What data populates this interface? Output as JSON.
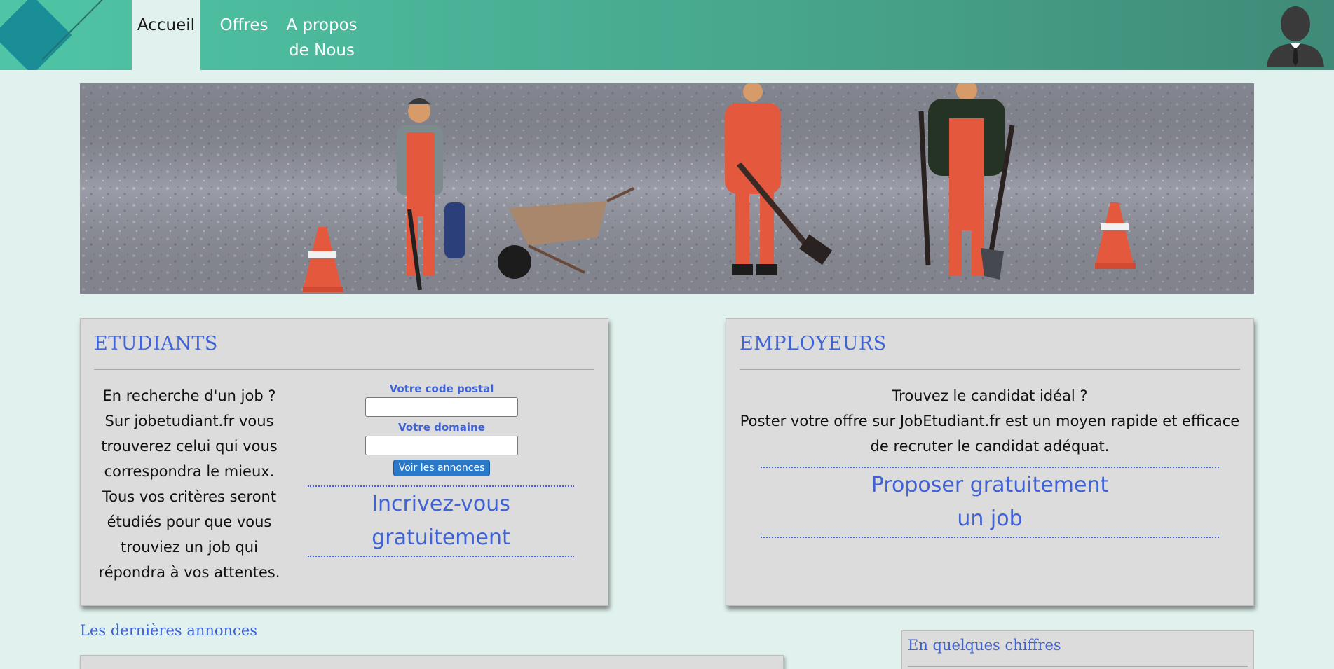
{
  "nav": {
    "items": [
      {
        "label": "Accueil",
        "active": true
      },
      {
        "label": "Offres",
        "active": false
      },
      {
        "label_line1": "A propos",
        "label_line2": "de Nous",
        "active": false
      }
    ]
  },
  "students": {
    "title": "ETUDIANTS",
    "text": "En recherche d'un job ? Sur jobetudiant.fr vous trouverez celui qui vous correspondra le mieux. Tous vos critères seront étudiés pour que vous trouviez un job qui répondra à vos attentes.",
    "postal_label": "Votre code postal",
    "postal_value": "",
    "domain_label": "Votre domaine",
    "domain_value": "",
    "search_button": "Voir les annonces",
    "signup_line1": "Incrivez-vous",
    "signup_line2": "gratuitement"
  },
  "employers": {
    "title": "EMPLOYEURS",
    "line1": "Trouvez le candidat idéal ?",
    "line2": "Poster votre offre sur JobEtudiant.fr est un moyen rapide et efficace de recruter le candidat adéquat.",
    "propose_line1": "Proposer gratuitement",
    "propose_line2": "un job"
  },
  "latest": {
    "title": "Les dernières annonces"
  },
  "figures": {
    "title": "En quelques chiffres"
  },
  "colors": {
    "accent_blue": "#3f63d6",
    "header_green": "#47a58b",
    "page_bg": "#e1f2ee"
  }
}
